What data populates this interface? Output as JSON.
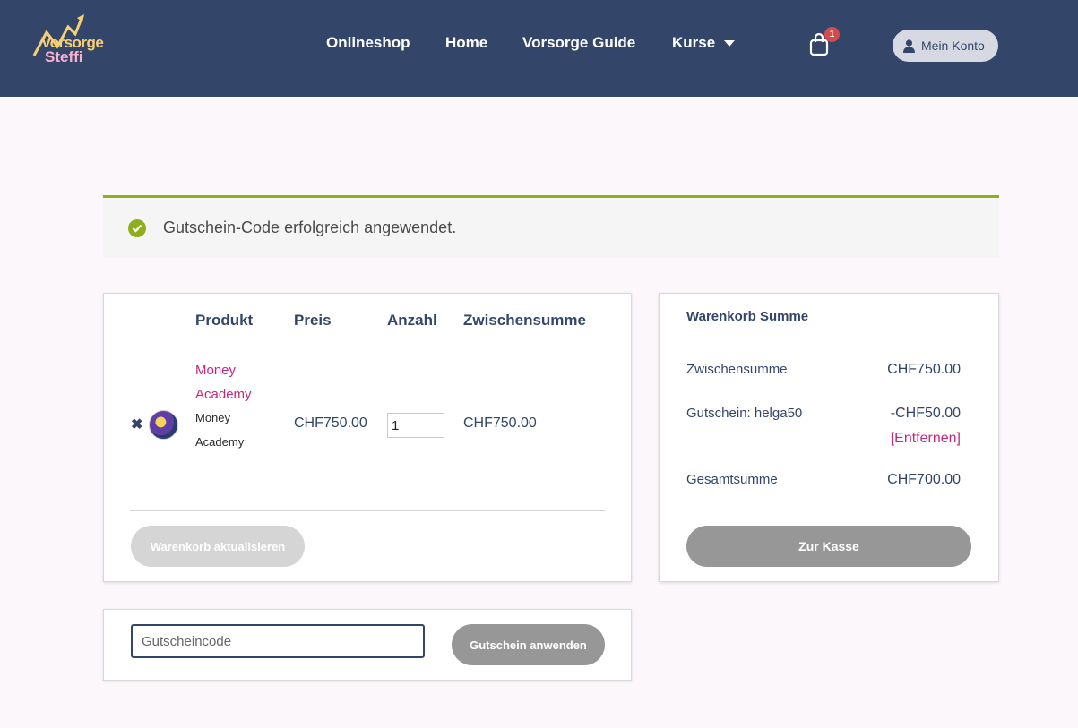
{
  "header": {
    "logo": {
      "line1": "Vorsorge",
      "line2": "Steffi"
    },
    "nav": [
      {
        "label": "Onlineshop"
      },
      {
        "label": "Home"
      },
      {
        "label": "Vorsorge Guide"
      },
      {
        "label": "Kurse",
        "has_dropdown": true
      }
    ],
    "cart": {
      "icon": "shopping-bag-icon",
      "count": "1"
    },
    "account": {
      "icon": "user-icon",
      "label": "Mein Konto"
    }
  },
  "notice": {
    "icon": "check-circle-icon",
    "text": "Gutschein-Code erfolgreich angewendet.",
    "color": "#8fae1b"
  },
  "cart_table": {
    "headers": {
      "product": "Produkt",
      "price": "Preis",
      "quantity": "Anzahl",
      "subtotal": "Zwischensumme"
    },
    "items": [
      {
        "name": "Money Academy",
        "variant": "Money Academy",
        "price": "CHF750.00",
        "quantity": "1",
        "subtotal": "CHF750.00"
      }
    ],
    "update_label": "Warenkorb aktualisieren"
  },
  "totals": {
    "title": "Warenkorb Summe",
    "subtotal_label": "Zwischensumme",
    "subtotal_value": "CHF750.00",
    "coupon_label": "Gutschein: helga50",
    "coupon_value": "-CHF50.00",
    "coupon_remove": "[Entfernen]",
    "total_label": "Gesamtsumme",
    "total_value": "CHF700.00",
    "checkout_label": "Zur Kasse"
  },
  "coupon": {
    "placeholder": "Gutscheincode",
    "apply_label": "Gutschein anwenden"
  },
  "colors": {
    "header_bg": "#33466a",
    "accent_pink": "#c6267c",
    "success_green": "#8fae1b",
    "page_bg": "#fcf7fb"
  }
}
